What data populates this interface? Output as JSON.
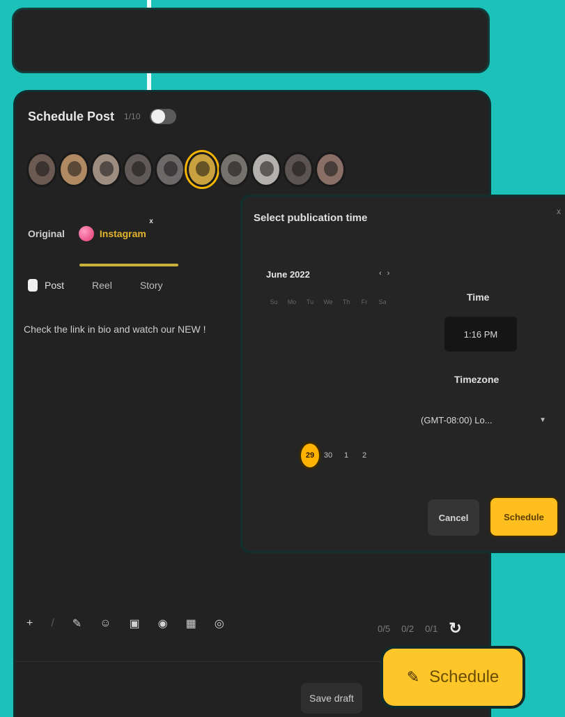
{
  "composer": {
    "title": "Schedule Post",
    "count": "1/10",
    "avatars": [
      {
        "color": "#6b5a52"
      },
      {
        "color": "#b08a62"
      },
      {
        "color": "#9d8d80"
      },
      {
        "color": "#5f5a57"
      },
      {
        "color": "#6d6968"
      },
      {
        "color": "#c9a23f",
        "selected": true
      },
      {
        "color": "#75726d"
      },
      {
        "color": "#b3b1ae"
      },
      {
        "color": "#5b5452"
      },
      {
        "color": "#8a6f66"
      }
    ],
    "platforms": {
      "original": "Original",
      "instagram": "Instagram",
      "close": "x"
    },
    "types": {
      "post": "Post",
      "reel": "Reel",
      "story": "Story"
    },
    "content": "Check the link in bio and watch our NEW !",
    "toolbar": {
      "add": "+",
      "sep": "/",
      "tag": "✎",
      "emoji": "☺",
      "image": "▣",
      "gif": "◉",
      "grid": "▦",
      "eye": "◎"
    },
    "counts": {
      "a": "0/5",
      "b": "0/2",
      "c": "0/1",
      "redo": "↻"
    },
    "save_draft": "Save draft",
    "schedule": "Schedule",
    "schedule_icon": "✎"
  },
  "popup": {
    "title": "Select publication time",
    "close": "x",
    "month": "June 2022",
    "prev": "‹",
    "next": "›",
    "weekdays": [
      "Su",
      "Mo",
      "Tu",
      "We",
      "Th",
      "Fr",
      "Sa"
    ],
    "visible_days": [
      "29",
      "30",
      "1",
      "2"
    ],
    "selected_day": "29",
    "time_label": "Time",
    "time_value": "1:16 PM",
    "timezone_label": "Timezone",
    "timezone_value": "(GMT-08:00) Lo...",
    "cancel": "Cancel",
    "schedule": "Schedule"
  }
}
